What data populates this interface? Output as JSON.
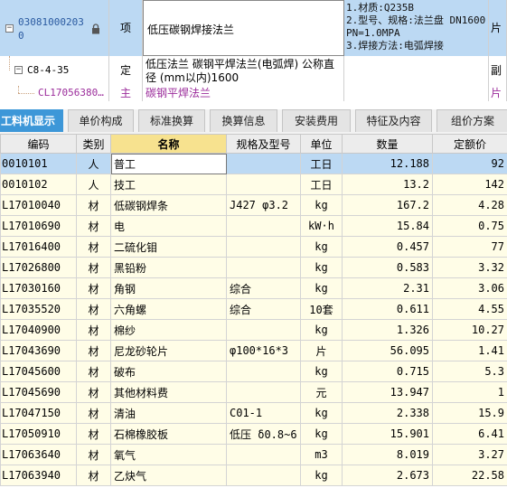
{
  "colors": {
    "accent": "#3d97d8",
    "selected_row": "#bcd9f3",
    "row_bg": "#fffde7",
    "name_header": "#f7e28f",
    "purple_text": "#9b2c9b"
  },
  "tree": {
    "row1": {
      "code": "030810002030",
      "type": "项",
      "name": "低压碳钢焊接法兰",
      "features": [
        "1.材质:Q235B",
        "2.型号、规格:法兰盘 DN1600",
        "PN=1.0MPA",
        "3.焊接方法:电弧焊接"
      ],
      "unit": "片",
      "lock_icon": "lock-icon"
    },
    "row2": {
      "code": "C8-4-35",
      "type": "定",
      "name": "低压法兰 碳钢平焊法兰(电弧焊) 公称直径 (mm以内)1600",
      "unit": "副"
    },
    "row3": {
      "code": "CL17056380…",
      "type": "主",
      "name": "碳钢平焊法兰",
      "unit": "片"
    }
  },
  "tabs": [
    "工料机显示",
    "单价构成",
    "标准换算",
    "换算信息",
    "安装费用",
    "特征及内容",
    "组价方案"
  ],
  "grid": {
    "headers": [
      "编码",
      "类别",
      "名称",
      "规格及型号",
      "单位",
      "数量",
      "定额价"
    ],
    "rows": [
      [
        "0010101",
        "人",
        "普工",
        "",
        "工日",
        "12.188",
        "92"
      ],
      [
        "0010102",
        "人",
        "技工",
        "",
        "工日",
        "13.2",
        "142"
      ],
      [
        "L17010040",
        "材",
        "低碳钢焊条",
        "J427 φ3.2",
        "kg",
        "167.2",
        "4.28"
      ],
      [
        "L17010690",
        "材",
        "电",
        "",
        "kW·h",
        "15.84",
        "0.75"
      ],
      [
        "L17016400",
        "材",
        "二硫化钼",
        "",
        "kg",
        "0.457",
        "77"
      ],
      [
        "L17026800",
        "材",
        "黑铅粉",
        "",
        "kg",
        "0.583",
        "3.32"
      ],
      [
        "L17030160",
        "材",
        "角钢",
        "综合",
        "kg",
        "2.31",
        "3.06"
      ],
      [
        "L17035520",
        "材",
        "六角螺",
        "综合",
        "10套",
        "0.611",
        "4.55"
      ],
      [
        "L17040900",
        "材",
        "棉纱",
        "",
        "kg",
        "1.326",
        "10.27"
      ],
      [
        "L17043690",
        "材",
        "尼龙砂轮片",
        "φ100*16*3",
        "片",
        "56.095",
        "1.41"
      ],
      [
        "L17045600",
        "材",
        "破布",
        "",
        "kg",
        "0.715",
        "5.3"
      ],
      [
        "L17045690",
        "材",
        "其他材料费",
        "",
        "元",
        "13.947",
        "1"
      ],
      [
        "L17047150",
        "材",
        "清油",
        "C01-1",
        "kg",
        "2.338",
        "15.9"
      ],
      [
        "L17050910",
        "材",
        "石棉橡胶板",
        "低压 δ0.8~6",
        "kg",
        "15.901",
        "6.41"
      ],
      [
        "L17063640",
        "材",
        "氧气",
        "",
        "m3",
        "8.019",
        "3.27"
      ],
      [
        "L17063940",
        "材",
        "乙炔气",
        "",
        "kg",
        "2.673",
        "22.58"
      ]
    ]
  }
}
